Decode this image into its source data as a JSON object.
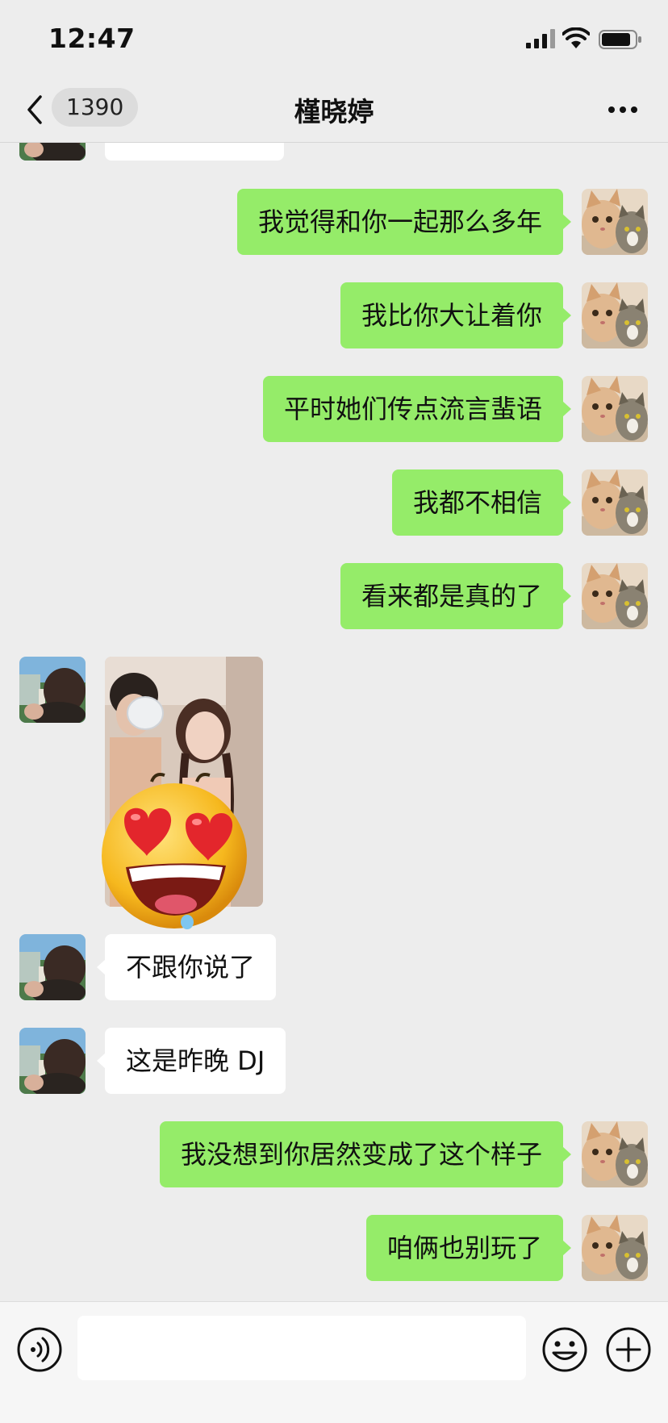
{
  "status_bar": {
    "time": "12:47"
  },
  "nav": {
    "unread_count": "1390",
    "title": "槿晓婷"
  },
  "messages": [
    {
      "side": "recv",
      "text": ""
    },
    {
      "side": "sent",
      "text": "我觉得和你一起那么多年"
    },
    {
      "side": "sent",
      "text": "我比你大让着你"
    },
    {
      "side": "sent",
      "text": "平时她们传点流言蜚语"
    },
    {
      "side": "sent",
      "text": "我都不相信"
    },
    {
      "side": "sent",
      "text": "看来都是真的了"
    },
    {
      "side": "recv",
      "type": "image"
    },
    {
      "side": "recv",
      "text": "不跟你说了"
    },
    {
      "side": "recv",
      "text": "这是昨晚 DJ"
    },
    {
      "side": "sent",
      "text": "我没想到你居然变成了这个样子"
    },
    {
      "side": "sent",
      "text": "咱俩也别玩了"
    }
  ],
  "input": {
    "value": "",
    "placeholder": ""
  },
  "colors": {
    "sent_bubble": "#95ec69",
    "recv_bubble": "#ffffff",
    "background": "#ededed"
  },
  "icons": [
    "back-icon",
    "more-icon",
    "voice-icon",
    "emoji-icon",
    "plus-icon"
  ]
}
